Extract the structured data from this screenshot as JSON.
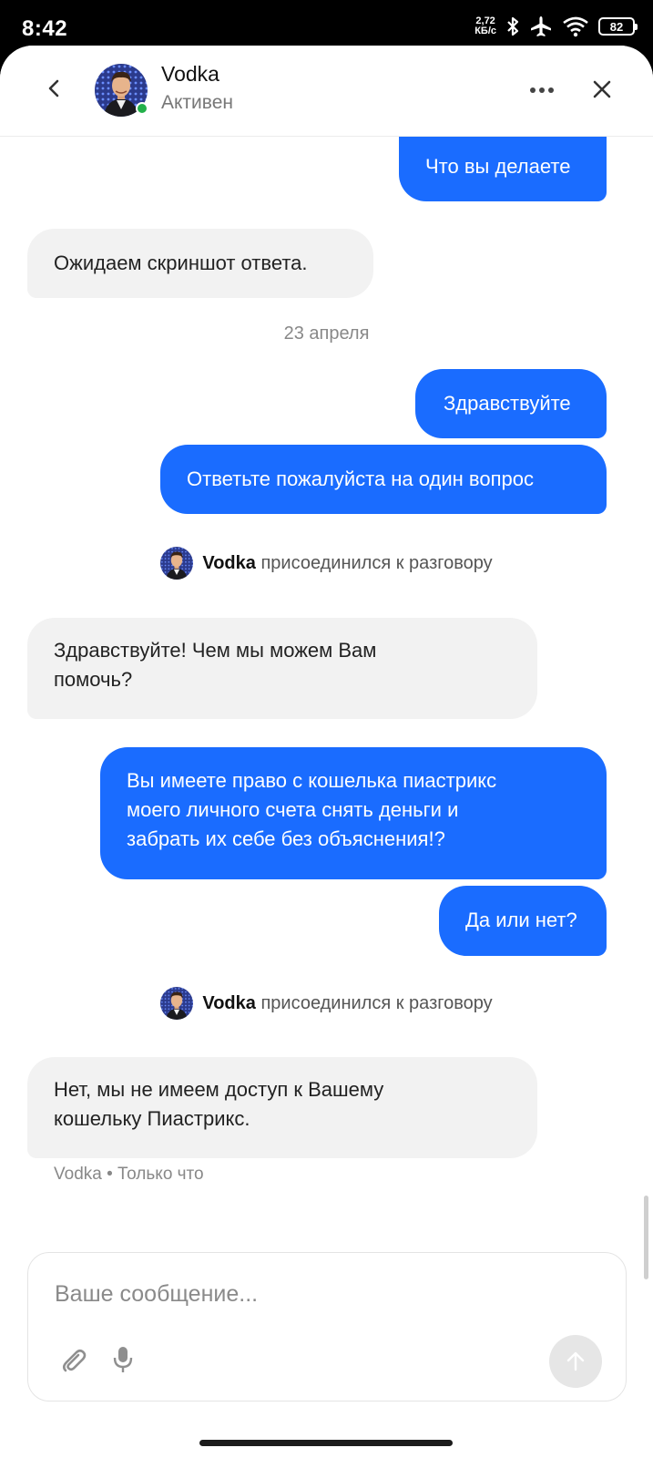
{
  "status_bar": {
    "time": "8:42",
    "net_speed_value": "2,72",
    "net_speed_unit": "КБ/с",
    "battery": "82",
    "icons": [
      "bluetooth-icon",
      "airplane-icon",
      "wifi-icon",
      "battery-icon"
    ]
  },
  "header": {
    "name": "Vodka",
    "status": "Активен",
    "icons": [
      "back-icon",
      "more-icon",
      "close-icon"
    ]
  },
  "messages": {
    "m1": "Что вы делаете",
    "m2": "Ожидаем скриншот ответа.",
    "date": "23 апреля",
    "m3": "Здравствуйте",
    "m4": "Ответьте пожалуйста на один вопрос",
    "sys1_name": "Vodka",
    "sys1_text": "присоединился к разговору",
    "m5_line1": "Здравствуйте! Чем мы можем Вам",
    "m5_line2": "помочь?",
    "m6_line1": "Вы имеете право с кошелька пиастрикс",
    "m6_line2": "моего личного счета снять деньги и",
    "m6_line3": "забрать их себе без объяснения!?",
    "m7": "Да или нет?",
    "sys2_name": "Vodka",
    "sys2_text": "присоединился к разговору",
    "m8_line1": "Нет, мы не имеем доступ к Вашему",
    "m8_line2": "кошельку Пиастрикс.",
    "m8_meta": "Vodka • Только что"
  },
  "composer": {
    "placeholder": "Ваше сообщение...",
    "icons": [
      "paperclip-icon",
      "microphone-icon",
      "send-arrow-icon"
    ]
  },
  "colors": {
    "outgoing_bubble": "#1a6cff",
    "incoming_bubble": "#f2f2f2",
    "online": "#23b04a"
  }
}
